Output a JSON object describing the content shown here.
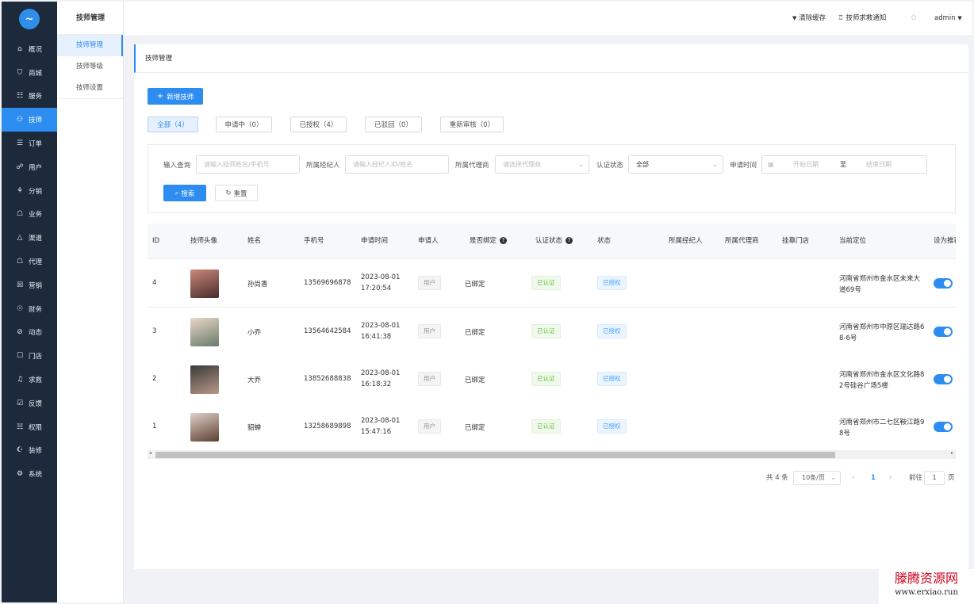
{
  "sidebar": {
    "logo": "~",
    "items": [
      {
        "icon": "⌂",
        "label": "概况"
      },
      {
        "icon": "⛉",
        "label": "商城"
      },
      {
        "icon": "☷",
        "label": "服务"
      },
      {
        "icon": "⚇",
        "label": "技师"
      },
      {
        "icon": "☰",
        "label": "订单"
      },
      {
        "icon": "☍",
        "label": "用户"
      },
      {
        "icon": "⚘",
        "label": "分销"
      },
      {
        "icon": "☖",
        "label": "业务"
      },
      {
        "icon": "△",
        "label": "渠道"
      },
      {
        "icon": "☖",
        "label": "代理"
      },
      {
        "icon": "☒",
        "label": "营销"
      },
      {
        "icon": "☉",
        "label": "财务"
      },
      {
        "icon": "⊘",
        "label": "动态"
      },
      {
        "icon": "☐",
        "label": "门店"
      },
      {
        "icon": "♫",
        "label": "求救"
      },
      {
        "icon": "☑",
        "label": "反馈"
      },
      {
        "icon": "☵",
        "label": "权限"
      },
      {
        "icon": "☪",
        "label": "装修"
      },
      {
        "icon": "⚙",
        "label": "系统"
      }
    ]
  },
  "subnav": {
    "title": "技师管理",
    "items": [
      "技师管理",
      "技师等级",
      "技师设置"
    ]
  },
  "header": {
    "clear_cache": "清除缓存",
    "notify": "技师求救通知",
    "user": "admin"
  },
  "page": {
    "title": "技师管理",
    "add_button": "新增技师",
    "tabs": [
      "全部（4）",
      "申请中（0）",
      "已授权（4）",
      "已驳回（0）",
      "重新审核（0）"
    ]
  },
  "filter": {
    "query_label": "输入查询",
    "query_placeholder": "请输入技师姓名/手机号",
    "broker_label": "所属经纪人",
    "broker_placeholder": "请输入经纪人ID/姓名",
    "agent_label": "所属代理商",
    "agent_placeholder": "请选择代理商",
    "auth_label": "认证状态",
    "auth_value": "全部",
    "time_label": "申请时间",
    "start_placeholder": "开始日期",
    "to": "至",
    "end_placeholder": "结束日期",
    "search": "搜索",
    "reset": "重置"
  },
  "table": {
    "columns": [
      "ID",
      "技师头像",
      "姓名",
      "手机号",
      "申请时间",
      "申请人",
      "是否绑定",
      "认证状态",
      "状态",
      "所属经纪人",
      "所属代理商",
      "挂靠门店",
      "当前定位",
      "设为推荐"
    ],
    "rows": [
      {
        "id": "4",
        "name": "孙尚香",
        "phone": "13569696878",
        "date": "2023-08-01",
        "time": "17:20:54",
        "applicant": "用户",
        "bind": "已绑定",
        "auth": "已认证",
        "status": "已授权",
        "loc1": "河南省郑州市金水区未来大",
        "loc2": "道69号",
        "color1": "#c98a7a",
        "color2": "#4a2a2a"
      },
      {
        "id": "3",
        "name": "小乔",
        "phone": "13564642584",
        "date": "2023-08-01",
        "time": "16:41:38",
        "applicant": "用户",
        "bind": "已绑定",
        "auth": "已认证",
        "status": "已授权",
        "loc1": "河南省郑州市中原区瑞达路6",
        "loc2": "8-6号",
        "color1": "#e8d8c8",
        "color2": "#6a7a6a"
      },
      {
        "id": "2",
        "name": "大乔",
        "phone": "13852688838",
        "date": "2023-08-01",
        "time": "16:18:32",
        "applicant": "用户",
        "bind": "已绑定",
        "auth": "已认证",
        "status": "已授权",
        "loc1": "河南省郑州市金水区文化路8",
        "loc2": "2号硅谷广场5楼",
        "color1": "#3a3a3a",
        "color2": "#b89888"
      },
      {
        "id": "1",
        "name": "貂蝉",
        "phone": "13258689898",
        "date": "2023-08-01",
        "time": "15:47:16",
        "applicant": "用户",
        "bind": "已绑定",
        "auth": "已认证",
        "status": "已授权",
        "loc1": "河南省郑州市二七区鞍江路9",
        "loc2": "8号",
        "color1": "#e0d0c8",
        "color2": "#5a4030"
      }
    ]
  },
  "pagination": {
    "total": "共 4 条",
    "page_size": "10条/页",
    "current": "1",
    "goto_prefix": "前往",
    "goto_value": "1",
    "goto_suffix": "页"
  },
  "watermark": {
    "line1": "滕腾资源网",
    "line2": "www.erxiao.run"
  }
}
